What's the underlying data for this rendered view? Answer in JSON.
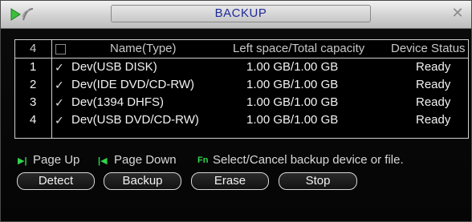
{
  "window": {
    "title": "BACKUP",
    "logo_icon": "arrow-wave-logo-icon",
    "close_icon": "close-icon"
  },
  "table": {
    "header": {
      "count": "4",
      "name": "Name(Type)",
      "space": "Left space/Total capacity",
      "status": "Device Status"
    },
    "rows": [
      {
        "index": "1",
        "checked": true,
        "name": "Dev(USB DISK)",
        "space": "1.00 GB/1.00 GB",
        "status": "Ready"
      },
      {
        "index": "2",
        "checked": true,
        "name": "Dev(IDE DVD/CD-RW)",
        "space": "1.00 GB/1.00 GB",
        "status": "Ready"
      },
      {
        "index": "3",
        "checked": true,
        "name": "Dev(1394 DHFS)",
        "space": "1.00 GB/1.00 GB",
        "status": "Ready"
      },
      {
        "index": "4",
        "checked": true,
        "name": "Dev(USB DVD/CD-RW)",
        "space": "1.00 GB/1.00 GB",
        "status": "Ready"
      }
    ]
  },
  "hints": {
    "page_up_icon": "▶|",
    "page_up": "Page Up",
    "page_down_icon": "|◀",
    "page_down": "Page Down",
    "fn_icon": "Fn",
    "fn_text": "Select/Cancel backup device or file."
  },
  "buttons": {
    "detect": "Detect",
    "backup": "Backup",
    "erase": "Erase",
    "stop": "Stop"
  },
  "colors": {
    "title_text": "#1f2a9c",
    "hint_icon": "#2fd34a",
    "background": "#000000"
  }
}
